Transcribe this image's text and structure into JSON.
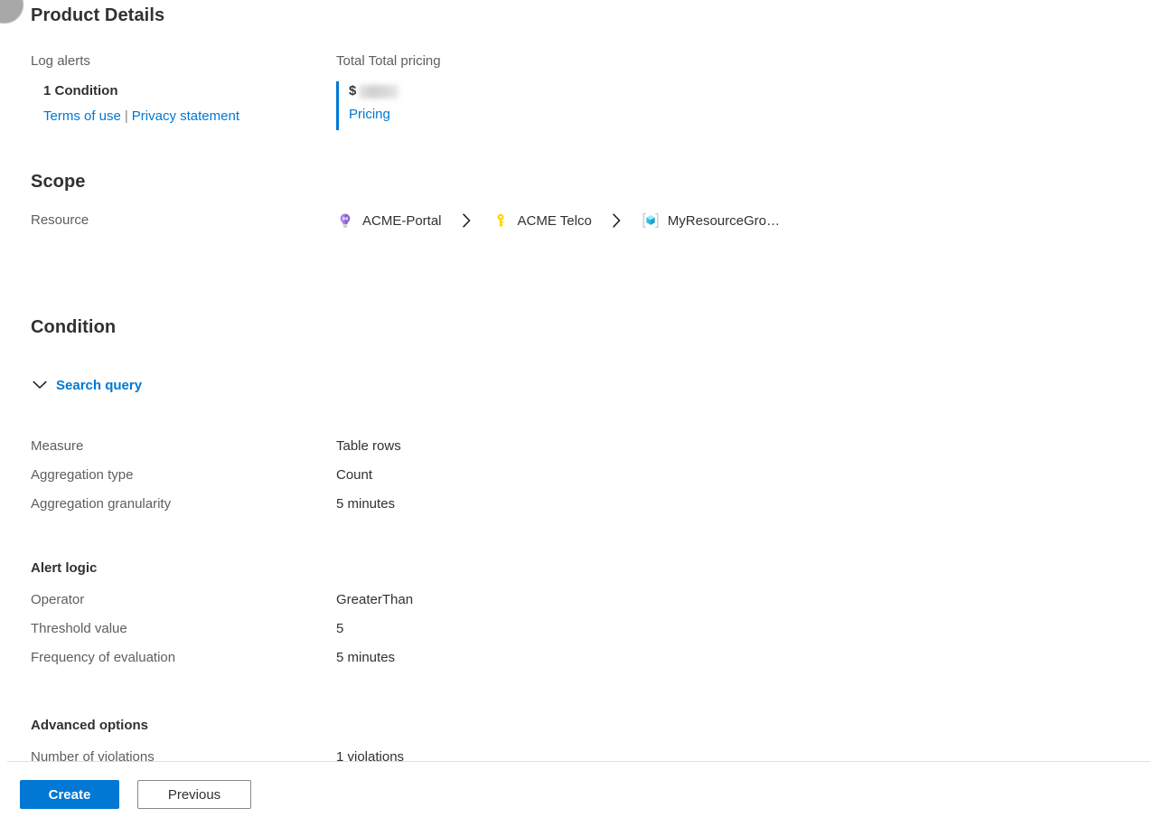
{
  "product_details": {
    "title": "Product Details",
    "left": {
      "caption": "Log alerts",
      "condition": "1 Condition",
      "terms_link": "Terms of use",
      "separator": "|",
      "privacy_link": "Privacy statement"
    },
    "right": {
      "caption": "Total Total pricing",
      "currency": "$",
      "amount_redacted": true,
      "pricing_link": "Pricing"
    },
    "accent_color": "#0078d4"
  },
  "scope": {
    "title": "Scope",
    "resource_label": "Resource",
    "breadcrumb": [
      {
        "label": "ACME-Portal",
        "icon": "tenant-icon"
      },
      {
        "label": "ACME Telco",
        "icon": "key-icon"
      },
      {
        "label": "MyResourceGro…",
        "icon": "resource-group-icon"
      }
    ],
    "separator_icon": "chevron-right-icon"
  },
  "condition": {
    "title": "Condition",
    "search_query": {
      "label": "Search query",
      "icon": "chevron-down-icon",
      "expanded": false
    },
    "measure_rows": [
      {
        "label": "Measure",
        "value": "Table rows"
      },
      {
        "label": "Aggregation type",
        "value": "Count"
      },
      {
        "label": "Aggregation granularity",
        "value": "5 minutes"
      }
    ],
    "alert_logic": {
      "title": "Alert logic",
      "rows": [
        {
          "label": "Operator",
          "value": "GreaterThan"
        },
        {
          "label": "Threshold value",
          "value": "5"
        },
        {
          "label": "Frequency of evaluation",
          "value": "5 minutes"
        }
      ]
    },
    "advanced_options": {
      "title": "Advanced options",
      "rows": [
        {
          "label": "Number of violations",
          "value": "1 violations"
        }
      ]
    }
  },
  "footer": {
    "create_label": "Create",
    "previous_label": "Previous",
    "primary_color": "#0078d4"
  }
}
